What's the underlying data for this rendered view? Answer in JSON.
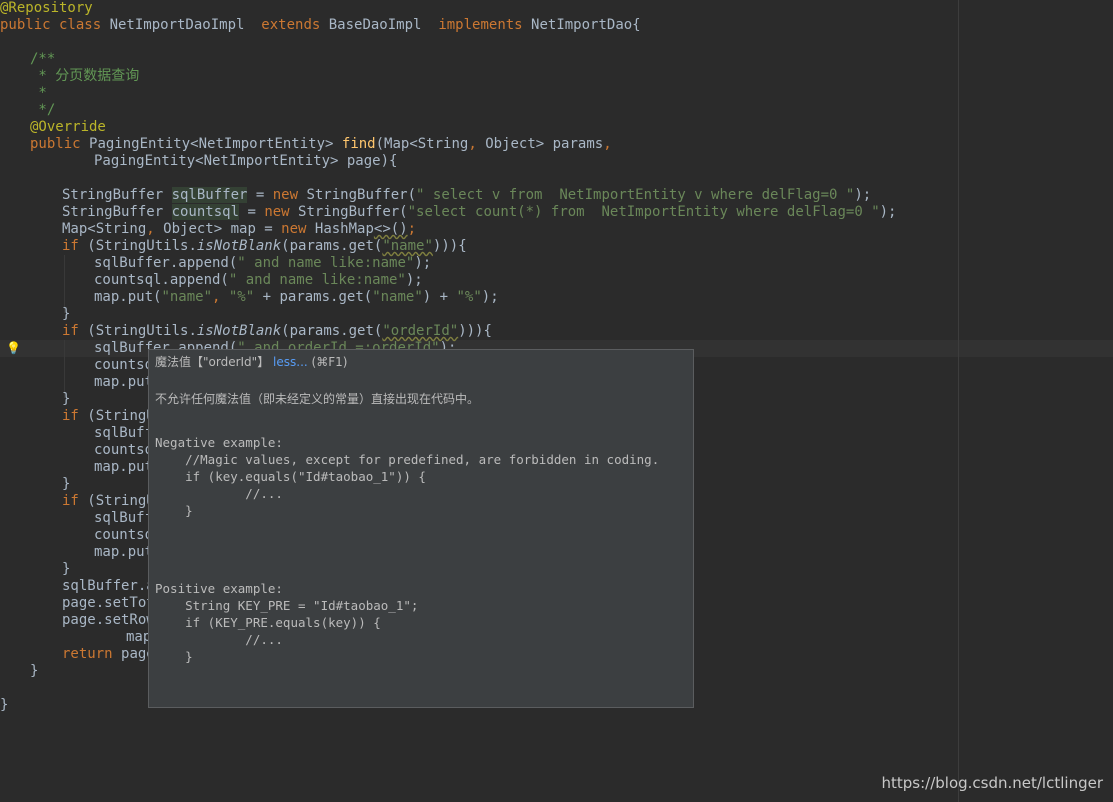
{
  "code": {
    "annotation_repository": "@Repository",
    "l2": {
      "kw1": "public class ",
      "cls": "NetImportDaoImpl  ",
      "kw2": "extends ",
      "base": "BaseDaoImpl  ",
      "kw3": "implements ",
      "iface": "NetImportDao{"
    },
    "doc_open": "/**",
    "doc_desc": " * 分页数据查询",
    "doc_star": " *",
    "doc_close": " */",
    "override": "@Override",
    "sig1": {
      "kw": "public ",
      "type": "PagingEntity<NetImportEntity> ",
      "fn": "find",
      "rest1": "(Map<String",
      "comma": ", ",
      "rest2": "Object> params",
      "comma2": ","
    },
    "sig2": "PagingEntity<NetImportEntity> page){",
    "l10": {
      "t": "StringBuffer ",
      "v": "sqlBuffer",
      "eq": " = ",
      "kw": "new ",
      "ctor": "StringBuffer(",
      "str": "\" select v from  NetImportEntity v where delFlag=0 \"",
      "end": ");"
    },
    "l11": {
      "t": "StringBuffer ",
      "v": "countsql",
      "eq": " = ",
      "kw": "new ",
      "ctor": "StringBuffer(",
      "str": "\"select count(*) from  NetImportEntity where delFlag=0 \"",
      "end": ");"
    },
    "l12": {
      "a": "Map<String",
      "c": ", ",
      "b": "Object> map = ",
      "kw": "new ",
      "ctor": "HashMap",
      "diamond": "<>()",
      "end": ";"
    },
    "l13": {
      "kw": "if ",
      "a": "(StringUtils.",
      "m": "isNotBlank",
      "b": "(params.get(",
      "str": "\"name\"",
      "c": "))){"
    },
    "l14": {
      "a": "sqlBuffer.append(",
      "str": "\" and name like:name\"",
      "b": ");"
    },
    "l15": {
      "a": "countsql.append(",
      "str": "\" and name like:name\"",
      "b": ");"
    },
    "l16": {
      "a": "map.put(",
      "s1": "\"name\"",
      "c1": ", ",
      "s2": "\"%\"",
      "b": " + params.get(",
      "s3": "\"name\"",
      "c": ") + ",
      "s4": "\"%\"",
      "d": ");"
    },
    "l17": "}",
    "l18": {
      "kw": "if ",
      "a": "(StringUtils.",
      "m": "isNotBlank",
      "b": "(params.get(",
      "str": "\"orderId\"",
      "c": "))){"
    },
    "l19": {
      "a": "sqlBuffer.append(",
      "str": "\" and orderId =:orderId\"",
      "b": ");"
    },
    "l20": "countsq",
    "l21": "map.put",
    "l22": "}",
    "l23": {
      "kw": "if ",
      "a": "(StringU"
    },
    "l24": "sqlBuff",
    "l25": "countsq",
    "l26": "map.put",
    "l27": "}",
    "l28": {
      "kw": "if ",
      "a": "(StringU"
    },
    "l29": "sqlBuff",
    "l30": "countsq",
    "l31": "map.put",
    "l32": "}",
    "l33": "sqlBuffer.a",
    "l34": "page.setTot",
    "l35": "page.setRow",
    "l36": "map",
    "l37": {
      "kw": "return ",
      "a": "page"
    },
    "l38": "}",
    "l40": "}"
  },
  "tooltip": {
    "title": "魔法值【\"orderId\"】",
    "less_link": "less...",
    "shortcut": "(⌘F1)",
    "description": "不允许任何魔法值（即未经定义的常量）直接出现在代码中。",
    "negative_code": "Negative example:\n    //Magic values, except for predefined, are forbidden in coding.\n    if (key.equals(\"Id#taobao_1\")) {\n            //...\n    }",
    "positive_code": "Positive example:\n    String KEY_PRE = \"Id#taobao_1\";\n    if (KEY_PRE.equals(key)) {\n            //...\n    }"
  },
  "watermark": "https://blog.csdn.net/lctlinger",
  "colors": {
    "background": "#2b2b2b",
    "keyword": "#cc7832",
    "string": "#6a8759",
    "comment": "#629755",
    "function": "#ffc66d",
    "annotation": "#bbb529",
    "link": "#589df6"
  },
  "icons": {
    "intention_bulb": "lightbulb-icon"
  }
}
